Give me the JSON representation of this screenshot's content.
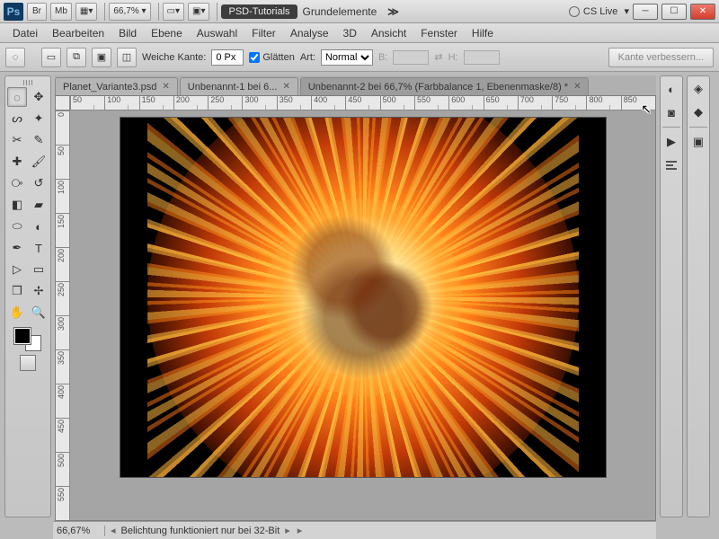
{
  "title": {
    "app_short": "Ps",
    "btn_br": "Br",
    "btn_mb": "Mb",
    "zoom": "66,7%",
    "tab_active": "PSD-Tutorials",
    "workspace": "Grundelemente",
    "cslive": "CS Live"
  },
  "menu": [
    "Datei",
    "Bearbeiten",
    "Bild",
    "Ebene",
    "Auswahl",
    "Filter",
    "Analyse",
    "3D",
    "Ansicht",
    "Fenster",
    "Hilfe"
  ],
  "options": {
    "feather_label": "Weiche Kante:",
    "feather_value": "0 Px",
    "antialias_label": "Glätten",
    "art_label": "Art:",
    "art_value": "Normal",
    "w_label": "B:",
    "h_label": "H:",
    "refine": "Kante verbessern..."
  },
  "doctabs": [
    {
      "label": "Planet_Variante3.psd",
      "active": false
    },
    {
      "label": "Unbenannt-1 bei 6...",
      "active": false
    },
    {
      "label": "Unbenannt-2 bei 66,7% (Farbbalance 1, Ebenenmaske/8) *",
      "active": true
    }
  ],
  "ruler_h": [
    "50",
    "100",
    "150",
    "200",
    "250",
    "300",
    "350",
    "400",
    "450",
    "500",
    "550",
    "600",
    "650",
    "700",
    "750",
    "800",
    "850"
  ],
  "ruler_v": [
    "0",
    "50",
    "100",
    "150",
    "200",
    "250",
    "300",
    "350",
    "400",
    "450",
    "500",
    "550"
  ],
  "status": {
    "zoom": "66,67%",
    "msg": "Belichtung funktioniert nur bei 32-Bit"
  }
}
